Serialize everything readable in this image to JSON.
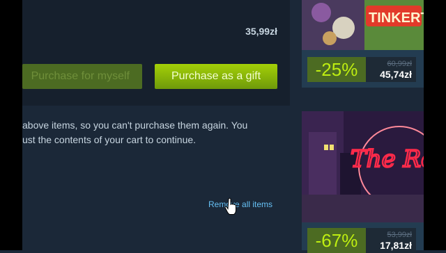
{
  "cart": {
    "total": "35,99zł",
    "purchase_self_label": "Purchase for myself",
    "purchase_gift_label": "Purchase as a gift",
    "notice_line1": "above items, so you can't purchase them again. You",
    "notice_line2": "ust the contents of your cart to continue.",
    "remove_all_label": "Remove all items"
  },
  "recommendations": [
    {
      "title_art": "TINKERTA",
      "discount": "-25%",
      "original_price": "60,99zł",
      "final_price": "45,74zł"
    },
    {
      "title_art": "The Red",
      "discount": "-67%",
      "original_price": "53,99zł",
      "final_price": "17,81zł"
    }
  ],
  "colors": {
    "page_bg": "#1b2838",
    "gift_button": "#a4d007",
    "discount_green": "#beee11",
    "link_blue": "#66c0f4",
    "neon_red": "#ff2a4a"
  }
}
